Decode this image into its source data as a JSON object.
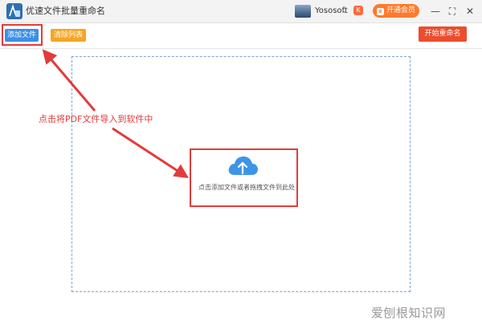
{
  "window": {
    "title": "优速文件批量重命名",
    "username": "Yososoft",
    "vip_badge": "K",
    "vip_button_label": "开通会员",
    "controls": {
      "minimize": "—",
      "maximize": "⛶",
      "close": "✕"
    }
  },
  "toolbar": {
    "add_file_label": "添加文件",
    "clear_list_label": "清除列表",
    "start_rename_label": "开始重命名"
  },
  "dropzone": {
    "hint": "点击添加文件或者拖拽文件到此处",
    "icon": "cloud-upload-icon"
  },
  "annotation": {
    "text": "点击将PDF文件导入到软件中"
  },
  "watermark": {
    "text": "爱刨根知识网"
  },
  "colors": {
    "add_button": "#3b8fe8",
    "clear_button": "#f5a623",
    "start_button": "#ec4d2d",
    "annotation": "#e23b3b",
    "cloud": "#3d95e8"
  }
}
